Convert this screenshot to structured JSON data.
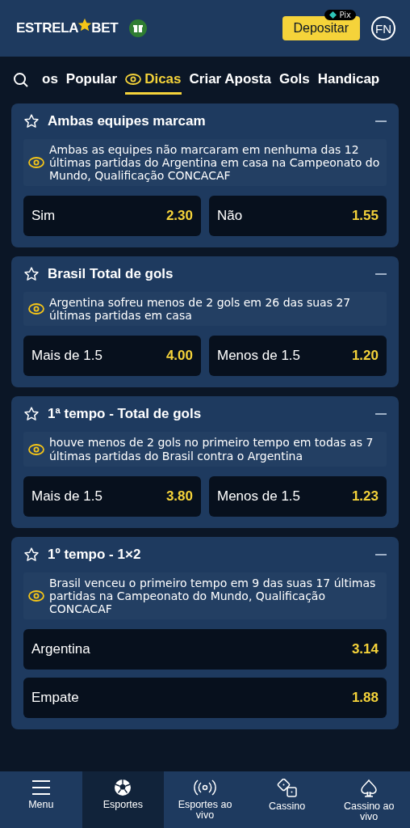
{
  "header": {
    "logo": {
      "left": "ESTRELA",
      "right": "BET"
    },
    "deposit": "Depositar",
    "pix": "Pix",
    "avatar": "FN"
  },
  "tabs": [
    {
      "label": "os",
      "selected": false,
      "icon": false
    },
    {
      "label": "Popular",
      "selected": false,
      "icon": false
    },
    {
      "label": "Dicas",
      "selected": true,
      "icon": true
    },
    {
      "label": "Criar Aposta",
      "selected": false,
      "icon": false
    },
    {
      "label": "Gols",
      "selected": false,
      "icon": false
    },
    {
      "label": "Handicap",
      "selected": false,
      "icon": false
    }
  ],
  "markets": [
    {
      "title": "Ambas equipes marcam",
      "tip": "Ambas as equipes não marcaram em nenhuma das 12 últimas partidas do Argentina em casa na Campeonato do Mundo, Qualificação CONCACAF",
      "kind": "grid",
      "options": [
        {
          "label": "Sim",
          "odds": "2.30"
        },
        {
          "label": "Não",
          "odds": "1.55"
        }
      ]
    },
    {
      "title": "Brasil Total de gols",
      "tip": "Argentina sofreu menos de 2 gols em 26 das suas 27 últimas partidas em casa",
      "kind": "grid",
      "options": [
        {
          "label": "Mais de 1.5",
          "odds": "4.00"
        },
        {
          "label": "Menos de 1.5",
          "odds": "1.20"
        }
      ]
    },
    {
      "title": "1ª tempo - Total de gols",
      "tip": "houve menos de 2 gols no primeiro tempo em todas as 7 últimas partidas do Brasil contra o Argentina",
      "kind": "grid",
      "options": [
        {
          "label": "Mais de 1.5",
          "odds": "3.80"
        },
        {
          "label": "Menos de 1.5",
          "odds": "1.23"
        }
      ]
    },
    {
      "title": "1º tempo - 1×2",
      "tip": "Brasil venceu o primeiro tempo em 9 das suas 17 últimas partidas na Campeonato do Mundo, Qualificação CONCACAF",
      "kind": "list",
      "options": [
        {
          "label": "Argentina",
          "odds": "3.14"
        },
        {
          "label": "Empate",
          "odds": "1.88"
        }
      ]
    }
  ],
  "nav": [
    {
      "label": "Menu",
      "kind": "menu",
      "selected": false
    },
    {
      "label": "Esportes",
      "kind": "ball",
      "selected": true
    },
    {
      "label": "Esportes ao vivo",
      "kind": "live",
      "selected": false
    },
    {
      "label": "Cassino",
      "kind": "dice",
      "selected": false
    },
    {
      "label": "Cassino ao vivo",
      "kind": "spade",
      "selected": false
    }
  ]
}
